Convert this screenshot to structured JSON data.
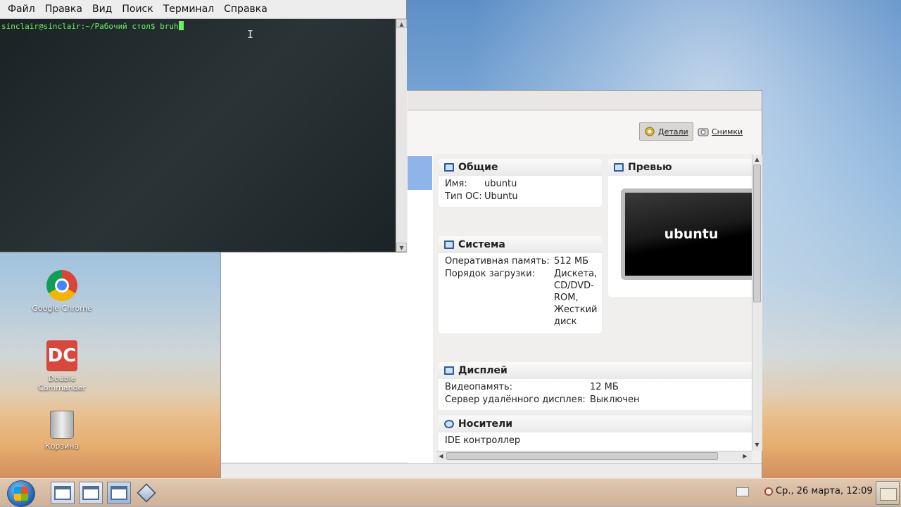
{
  "terminal": {
    "menu": [
      "Файл",
      "Правка",
      "Вид",
      "Поиск",
      "Терминал",
      "Справка"
    ],
    "prompt": "sinclair@sinclair:~/Рабочий стол$ bruh",
    "ibeam": "I"
  },
  "virtualbox": {
    "toolbar": {
      "details_label": "Детали",
      "snapshots_label": "Снимки"
    },
    "general": {
      "title": "Общие",
      "name_label": "Имя:",
      "name_value": "ubuntu",
      "os_label": "Тип ОС:",
      "os_value": "Ubuntu"
    },
    "preview": {
      "title": "Превью",
      "screen_text": "ubuntu"
    },
    "system": {
      "title": "Система",
      "memory_label": "Оперативная память:",
      "memory_value": "512 МБ",
      "boot_label": "Порядок загрузки:",
      "boot_lines": [
        "Дискета,",
        "CD/DVD-",
        "ROM,",
        "Жесткий",
        "диск"
      ]
    },
    "display": {
      "title": "Дисплей",
      "vram_label": "Видеопамять:",
      "vram_value": "12 МБ",
      "rdp_label": "Сервер удалённого дисплея:",
      "rdp_value": "Выключен"
    },
    "storage": {
      "title": "Носители",
      "controller": "IDE контроллер"
    }
  },
  "desktop": {
    "icons": [
      {
        "label": "Google Chrome",
        "icon": "chrome-icon"
      },
      {
        "label": "Double Commander",
        "icon": "double-commander-icon",
        "glyph": "DC"
      },
      {
        "label": "Корзина",
        "icon": "trash-icon"
      }
    ]
  },
  "taskbar": {
    "clock": "Ср., 26 марта, 12:09"
  }
}
